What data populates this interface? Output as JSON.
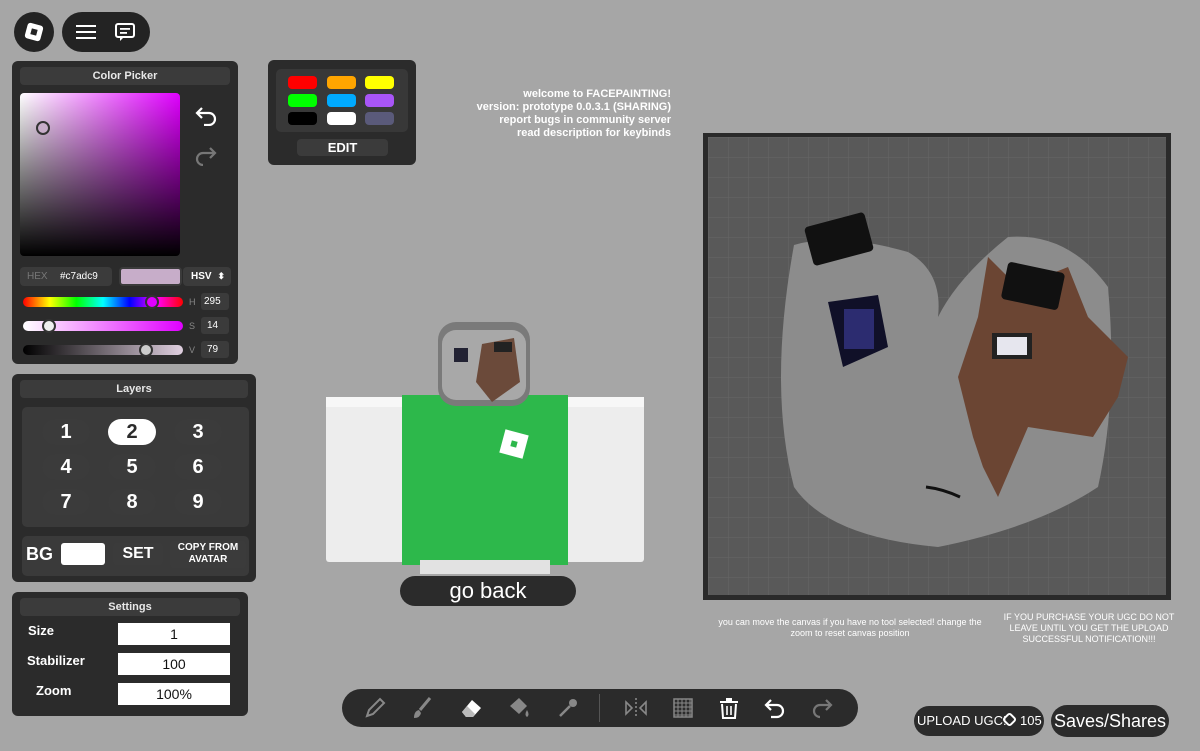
{
  "top": {
    "roblox_icon": "roblox-logo-icon",
    "menu_icon": "hamburger-menu-icon",
    "chat_icon": "chat-icon"
  },
  "color_picker": {
    "title": "Color Picker",
    "hex_label": "HEX",
    "hex_value": "#c7adc9",
    "mode": "HSV",
    "h_label": "H",
    "h_value": "295",
    "s_label": "S",
    "s_value": "14",
    "v_label": "V",
    "v_value": "79",
    "h_level": 0.82,
    "s_level": 0.14,
    "v_level": 0.79,
    "selected_color": "#c7adc9"
  },
  "palette": {
    "colors": [
      "#ff0000",
      "#ffa500",
      "#ffff00",
      "#00ff00",
      "#00aaff",
      "#a855f7",
      "#000000",
      "#ffffff",
      "#5a5a7a"
    ],
    "edit_label": "EDIT"
  },
  "info_text": {
    "line1": "welcome to FACEPAINTING!",
    "line2": "version: prototype 0.0.3.1 (SHARING)",
    "line3": "report bugs in community server",
    "line4": "read description for keybinds"
  },
  "layers": {
    "title": "Layers",
    "numbers": [
      "1",
      "2",
      "3",
      "4",
      "5",
      "6",
      "7",
      "8",
      "9"
    ],
    "active": "2",
    "bg_label": "BG",
    "set_label": "SET",
    "copy_label_1": "COPY FROM",
    "copy_label_2": "AVATAR",
    "bg_color": "#ffffff"
  },
  "settings": {
    "title": "Settings",
    "size_label": "Size",
    "size_value": "1",
    "stabilizer_label": "Stabilizer",
    "stabilizer_value": "100",
    "zoom_label": "Zoom",
    "zoom_value": "100%"
  },
  "avatar": {
    "go_back_label": "go back",
    "shirt_color": "#2db84b"
  },
  "canvas_note": "you can move the canvas if you have no tool selected! change the zoom to reset canvas position",
  "ugc_note": "IF YOU PURCHASE YOUR UGC DO NOT LEAVE UNTIL YOU GET THE UPLOAD SUCCESSFUL NOTIFICATION!!!",
  "toolbar": {
    "tools": [
      "pencil-icon",
      "brush-icon",
      "eraser-icon",
      "bucket-icon",
      "eyedropper-icon",
      "mirror-icon",
      "grid-icon",
      "trash-icon",
      "undo-icon",
      "redo-icon"
    ]
  },
  "bottom_right": {
    "upload_label": "UPLOAD UGC!",
    "price": "105",
    "saves_label": "Saves/Shares"
  }
}
